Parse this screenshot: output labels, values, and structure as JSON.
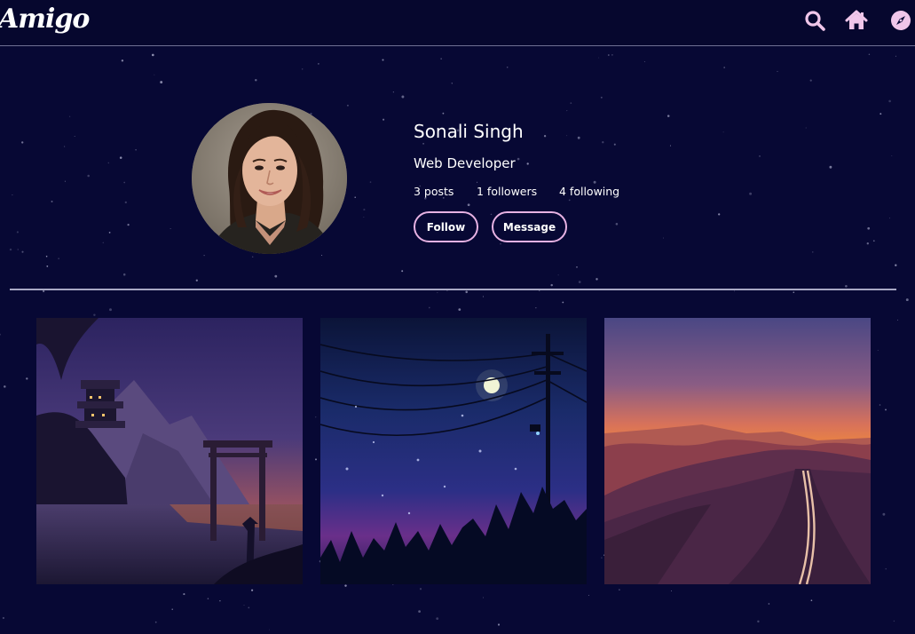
{
  "header": {
    "logo_text": "Amigo",
    "icons": [
      "search-icon",
      "home-icon",
      "compass-icon"
    ],
    "icon_color": "#f0c6ea"
  },
  "profile": {
    "name": "Sonali Singh",
    "role": "Web Developer",
    "stats": {
      "posts": "3 posts",
      "followers": "1 followers",
      "following": "4 following"
    },
    "follow_label": "Follow",
    "message_label": "Message",
    "button_border_color": "#e7b2e3"
  },
  "posts": [
    {
      "name": "pagoda-torii-night-artwork"
    },
    {
      "name": "moon-power-lines-night-artwork"
    },
    {
      "name": "sunset-highway-artwork"
    }
  ],
  "colors": {
    "background": "#070834",
    "divider": "#a8a8c4"
  }
}
